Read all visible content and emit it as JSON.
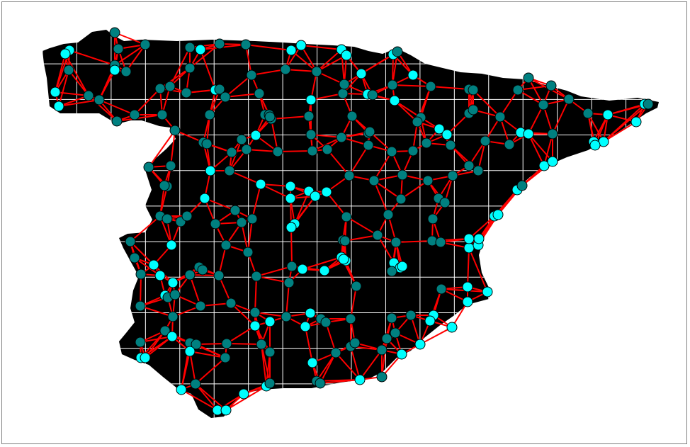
{
  "colors": {
    "background": "#ffffff",
    "frame_border": "#808080",
    "land": "#000000",
    "grid": "#ffffff",
    "edge": "#ff0000",
    "node_light": "#00ffff",
    "node_dark": "#008080",
    "node_stroke": "#000000"
  },
  "map": {
    "region_name": "",
    "grid": true,
    "grid_cells": {
      "cols": 18,
      "rows": 11
    },
    "edge_connection_count": 4
  },
  "nodes": [
    [
      162,
      46,
      1
    ],
    [
      205,
      63,
      1
    ],
    [
      268,
      67,
      1
    ],
    [
      283,
      70,
      0
    ],
    [
      310,
      62,
      1
    ],
    [
      347,
      63,
      1
    ],
    [
      411,
      71,
      0
    ],
    [
      425,
      64,
      0
    ],
    [
      482,
      70,
      0
    ],
    [
      489,
      78,
      0
    ],
    [
      555,
      77,
      0
    ],
    [
      561,
      73,
      1
    ],
    [
      98,
      71,
      0
    ],
    [
      92,
      76,
      0
    ],
    [
      167,
      69,
      1
    ],
    [
      97,
      99,
      1
    ],
    [
      162,
      92,
      1
    ],
    [
      162,
      99,
      0
    ],
    [
      178,
      101,
      1
    ],
    [
      268,
      96,
      1
    ],
    [
      355,
      106,
      1
    ],
    [
      403,
      98,
      1
    ],
    [
      447,
      101,
      1
    ],
    [
      510,
      104,
      0
    ],
    [
      583,
      106,
      0
    ],
    [
      78,
      130,
      0
    ],
    [
      83,
      150,
      0
    ],
    [
      125,
      135,
      1
    ],
    [
      140,
      141,
      1
    ],
    [
      226,
      125,
      1
    ],
    [
      240,
      122,
      1
    ],
    [
      263,
      131,
      1
    ],
    [
      304,
      127,
      0
    ],
    [
      310,
      126,
      1
    ],
    [
      318,
      137,
      1
    ],
    [
      366,
      132,
      1
    ],
    [
      439,
      141,
      0
    ],
    [
      484,
      132,
      1
    ],
    [
      486,
      119,
      1
    ],
    [
      519,
      133,
      0
    ],
    [
      526,
      134,
      1
    ],
    [
      554,
      120,
      1
    ],
    [
      557,
      142,
      0
    ],
    [
      608,
      122,
      1
    ],
    [
      662,
      126,
      1
    ],
    [
      668,
      127,
      1
    ],
    [
      731,
      127,
      1
    ],
    [
      746,
      110,
      1
    ],
    [
      778,
      121,
      1
    ],
    [
      165,
      171,
      1
    ],
    [
      190,
      162,
      1
    ],
    [
      229,
      162,
      1
    ],
    [
      296,
      162,
      1
    ],
    [
      374,
      162,
      1
    ],
    [
      380,
      162,
      1
    ],
    [
      383,
      168,
      1
    ],
    [
      381,
      165,
      1
    ],
    [
      436,
      164,
      1
    ],
    [
      497,
      164,
      1
    ],
    [
      594,
      166,
      1
    ],
    [
      589,
      172,
      1
    ],
    [
      662,
      160,
      1
    ],
    [
      668,
      155,
      1
    ],
    [
      706,
      165,
      1
    ],
    [
      767,
      148,
      1
    ],
    [
      803,
      140,
      1
    ],
    [
      830,
      160,
      1
    ],
    [
      858,
      162,
      0
    ],
    [
      910,
      147,
      0
    ],
    [
      915,
      147,
      1
    ],
    [
      898,
      172,
      0
    ],
    [
      247,
      184,
      1
    ],
    [
      361,
      191,
      0
    ],
    [
      439,
      190,
      1
    ],
    [
      482,
      194,
      1
    ],
    [
      520,
      188,
      1
    ],
    [
      522,
      186,
      1
    ],
    [
      620,
      182,
      0
    ],
    [
      631,
      190,
      0
    ],
    [
      735,
      187,
      0
    ],
    [
      746,
      189,
      0
    ],
    [
      780,
      189,
      1
    ],
    [
      838,
      200,
      0
    ],
    [
      852,
      200,
      0
    ],
    [
      840,
      205,
      0
    ],
    [
      287,
      201,
      1
    ],
    [
      292,
      203,
      1
    ],
    [
      341,
      197,
      1
    ],
    [
      327,
      215,
      1
    ],
    [
      348,
      211,
      1
    ],
    [
      392,
      214,
      1
    ],
    [
      441,
      213,
      1
    ],
    [
      462,
      211,
      1
    ],
    [
      520,
      205,
      1
    ],
    [
      553,
      214,
      1
    ],
    [
      583,
      213,
      1
    ],
    [
      602,
      202,
      1
    ],
    [
      636,
      205,
      1
    ],
    [
      685,
      199,
      1
    ],
    [
      719,
      204,
      1
    ],
    [
      210,
      236,
      1
    ],
    [
      241,
      234,
      1
    ],
    [
      297,
      241,
      0
    ],
    [
      324,
      241,
      1
    ],
    [
      493,
      248,
      1
    ],
    [
      528,
      255,
      1
    ],
    [
      568,
      247,
      1
    ],
    [
      604,
      255,
      1
    ],
    [
      639,
      248,
      1
    ],
    [
      662,
      234,
      1
    ],
    [
      675,
      241,
      1
    ],
    [
      768,
      234,
      0
    ],
    [
      780,
      228,
      0
    ],
    [
      236,
      263,
      1
    ],
    [
      232,
      262,
      1
    ],
    [
      289,
      280,
      0
    ],
    [
      368,
      260,
      0
    ],
    [
      410,
      263,
      0
    ],
    [
      436,
      270,
      0
    ],
    [
      445,
      277,
      0
    ],
    [
      461,
      271,
      0
    ],
    [
      410,
      280,
      0
    ],
    [
      566,
      281,
      1
    ],
    [
      619,
      280,
      1
    ],
    [
      628,
      286,
      1
    ],
    [
      730,
      268,
      0
    ],
    [
      737,
      262,
      1
    ],
    [
      332,
      297,
      1
    ],
    [
      226,
      305,
      1
    ],
    [
      236,
      309,
      1
    ],
    [
      255,
      313,
      1
    ],
    [
      264,
      305,
      1
    ],
    [
      304,
      316,
      1
    ],
    [
      341,
      314,
      1
    ],
    [
      356,
      309,
      1
    ],
    [
      416,
      316,
      0
    ],
    [
      411,
      321,
      0
    ],
    [
      489,
      306,
      1
    ],
    [
      548,
      303,
      1
    ],
    [
      611,
      309,
      1
    ],
    [
      698,
      305,
      0
    ],
    [
      703,
      303,
      0
    ],
    [
      184,
      341,
      1
    ],
    [
      242,
      346,
      0
    ],
    [
      319,
      346,
      1
    ],
    [
      350,
      356,
      1
    ],
    [
      484,
      339,
      1
    ],
    [
      487,
      340,
      1
    ],
    [
      488,
      368,
      0
    ],
    [
      533,
      332,
      1
    ],
    [
      559,
      342,
      1
    ],
    [
      610,
      340,
      1
    ],
    [
      622,
      342,
      1
    ],
    [
      662,
      350,
      0
    ],
    [
      662,
      337,
      0
    ],
    [
      675,
      346,
      0
    ],
    [
      676,
      337,
      0
    ],
    [
      190,
      364,
      1
    ],
    [
      217,
      374,
      0
    ],
    [
      281,
      377,
      1
    ],
    [
      286,
      381,
      1
    ],
    [
      309,
      389,
      1
    ],
    [
      362,
      390,
      1
    ],
    [
      412,
      376,
      1
    ],
    [
      427,
      380,
      0
    ],
    [
      458,
      382,
      0
    ],
    [
      482,
      363,
      0
    ],
    [
      485,
      366,
      0
    ],
    [
      556,
      371,
      0
    ],
    [
      565,
      378,
      0
    ],
    [
      568,
      376,
      0
    ],
    [
      553,
      383,
      1
    ],
    [
      199,
      387,
      1
    ],
    [
      226,
      389,
      0
    ],
    [
      244,
      399,
      0
    ],
    [
      268,
      388,
      1
    ],
    [
      408,
      399,
      1
    ],
    [
      503,
      404,
      1
    ],
    [
      623,
      408,
      1
    ],
    [
      660,
      405,
      0
    ],
    [
      688,
      412,
      0
    ],
    [
      198,
      432,
      1
    ],
    [
      233,
      417,
      0
    ],
    [
      237,
      420,
      1
    ],
    [
      247,
      416,
      1
    ],
    [
      283,
      432,
      1
    ],
    [
      326,
      428,
      1
    ],
    [
      360,
      441,
      1
    ],
    [
      404,
      447,
      1
    ],
    [
      438,
      442,
      0
    ],
    [
      453,
      450,
      1
    ],
    [
      460,
      455,
      1
    ],
    [
      495,
      450,
      1
    ],
    [
      553,
      449,
      1
    ],
    [
      580,
      445,
      1
    ],
    [
      612,
      445,
      0
    ],
    [
      607,
      453,
      0
    ],
    [
      660,
      426,
      0
    ],
    [
      360,
      460,
      0
    ],
    [
      381,
      454,
      0
    ],
    [
      431,
      461,
      0
    ],
    [
      233,
      467,
      1
    ],
    [
      320,
      485,
      1
    ],
    [
      369,
      486,
      1
    ],
    [
      495,
      489,
      1
    ],
    [
      501,
      484,
      1
    ],
    [
      546,
      478,
      1
    ],
    [
      558,
      470,
      1
    ],
    [
      638,
      462,
      0
    ],
    [
      198,
      483,
      1
    ],
    [
      268,
      484,
      1
    ],
    [
      277,
      486,
      1
    ],
    [
      268,
      496,
      0
    ],
    [
      381,
      497,
      1
    ],
    [
      474,
      498,
      1
    ],
    [
      539,
      494,
      1
    ],
    [
      593,
      486,
      0
    ],
    [
      567,
      500,
      0
    ],
    [
      199,
      505,
      0
    ],
    [
      205,
      505,
      0
    ],
    [
      318,
      505,
      1
    ],
    [
      441,
      512,
      0
    ],
    [
      276,
      542,
      1
    ],
    [
      256,
      550,
      0
    ],
    [
      344,
      556,
      0
    ],
    [
      376,
      545,
      0
    ],
    [
      381,
      541,
      1
    ],
    [
      447,
      538,
      1
    ],
    [
      452,
      541,
      1
    ],
    [
      508,
      536,
      0
    ],
    [
      539,
      532,
      1
    ],
    [
      307,
      579,
      0
    ],
    [
      319,
      579,
      0
    ],
    [
      244,
      447,
      1
    ],
    [
      243,
      475,
      0
    ]
  ]
}
